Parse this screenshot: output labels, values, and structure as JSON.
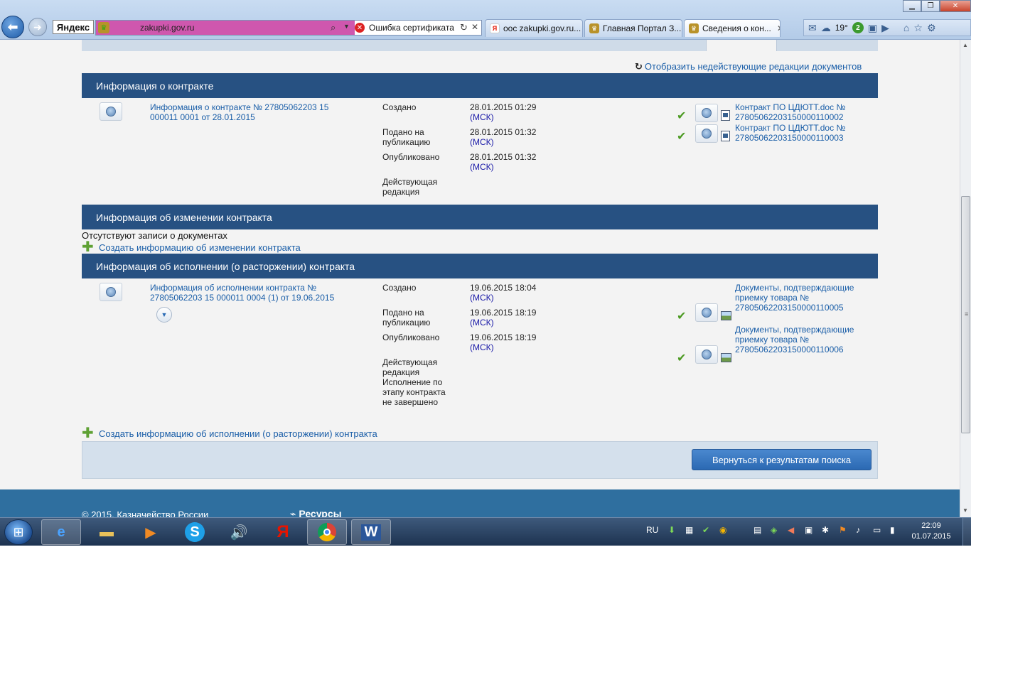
{
  "browser": {
    "window_controls": {
      "minimize": "▁",
      "maximize": "❐",
      "close": "✕"
    },
    "back_icon": "arrow-left-icon",
    "forward_icon": "arrow-right-icon",
    "yandex_logo": "Яндекс",
    "address": {
      "url": "zakupki.gov.ru",
      "cert_error": "Ошибка сертификата"
    },
    "tabs": [
      {
        "label": "оос zakupki.gov.ru...",
        "favicon": "Я"
      },
      {
        "label": "Главная Портал З...",
        "favicon": "crest"
      },
      {
        "label": "Сведения о кон...",
        "favicon": "crest",
        "close": "✕"
      }
    ],
    "weather": "19°",
    "notification_count": "2"
  },
  "page": {
    "show_inactive_link": "Отобразить недействующие редакции документов",
    "contract_info": {
      "header": "Информация о контракте",
      "record_link": "Информация о контракте № 27805062203 15 000011 0001 от 28.01.2015",
      "fields": [
        {
          "label": "Создано",
          "value": "28.01.2015 01:29",
          "tz": "(МСК)"
        },
        {
          "label": "Подано на публикацию",
          "value": "28.01.2015 01:32",
          "tz": "(МСК)"
        },
        {
          "label": "Опубликовано",
          "value": "28.01.2015 01:32",
          "tz": "(МСК)"
        },
        {
          "label": "Действующая редакция",
          "value": "",
          "tz": ""
        }
      ],
      "documents": [
        {
          "title": "Контракт ПО ЦДЮТТ.doc № 27805062203150000110002"
        },
        {
          "title": "Контракт ПО ЦДЮТТ.doc № 27805062203150000110003"
        }
      ]
    },
    "change_info": {
      "header": "Информация об изменении контракта",
      "empty_text": "Отсутствуют записи о документах",
      "create_link": "Создать информацию об изменении контракта"
    },
    "execution_info": {
      "header": "Информация об исполнении (о расторжении) контракта",
      "record_link": "Информация об исполнении контракта № 27805062203 15 000011 0004 (1) от 19.06.2015",
      "fields": [
        {
          "label": "Создано",
          "value": "19.06.2015 18:04",
          "tz": "(МСК)"
        },
        {
          "label": "Подано на публикацию",
          "value": "19.06.2015 18:19",
          "tz": "(МСК)"
        },
        {
          "label": "Опубликовано",
          "value": "19.06.2015 18:19",
          "tz": "(МСК)"
        },
        {
          "label": "Действующая редакция Исполнение по этапу контракта не завершено",
          "value": "",
          "tz": ""
        }
      ],
      "documents": [
        {
          "title": "Документы, подтверждающие приемку товара № 27805062203150000110005"
        },
        {
          "title": "Документы, подтверждающие приемку товара № 27805062203150000110006"
        }
      ],
      "create_link": "Создать информацию об исполнении (о расторжении) контракта"
    },
    "return_button": "Вернуться к результатам поиска",
    "footer": {
      "copyright": "© 2015. Казначейство России",
      "resources": "Ресурсы"
    }
  },
  "taskbar": {
    "language": "RU",
    "time": "22:09",
    "date": "01.07.2015"
  }
}
